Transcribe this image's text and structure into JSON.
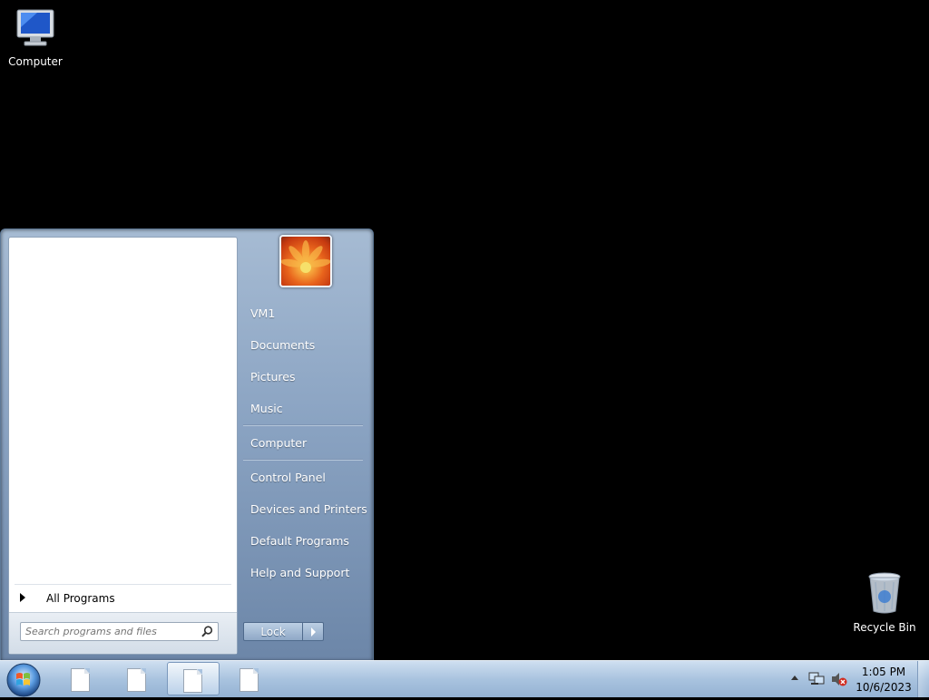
{
  "desktop": {
    "icons": [
      {
        "label": "Computer",
        "icon": "computer-icon"
      },
      {
        "label": "Recycle Bin",
        "icon": "recycle-bin-icon"
      }
    ]
  },
  "start_menu": {
    "all_programs_label": "All Programs",
    "search": {
      "placeholder": "Search programs and files",
      "value": ""
    },
    "user_picture": "user-flower-picture",
    "right_items": [
      {
        "label": "VM1"
      },
      {
        "label": "Documents"
      },
      {
        "label": "Pictures"
      },
      {
        "label": "Music"
      },
      {
        "label": "Computer"
      },
      {
        "label": "Control Panel"
      },
      {
        "label": "Devices and Printers"
      },
      {
        "label": "Default Programs"
      },
      {
        "label": "Help and Support"
      }
    ],
    "shutdown_label": "Lock"
  },
  "taskbar": {
    "start_orb": "windows-start-orb",
    "buttons": [
      {
        "icon": "document-icon",
        "active": false
      },
      {
        "icon": "document-icon",
        "active": false
      },
      {
        "icon": "document-icon",
        "active": true
      },
      {
        "icon": "document-icon",
        "active": false
      }
    ],
    "tray": {
      "icons": [
        "show-hidden-icons-arrow",
        "network-icon",
        "volume-muted-icon"
      ],
      "time": "1:05 PM",
      "date": "10/6/2023"
    }
  },
  "colors": {
    "desktop_background": "#000000",
    "start_menu_right": "#8aa3c2",
    "taskbar": "#a9c3df"
  }
}
